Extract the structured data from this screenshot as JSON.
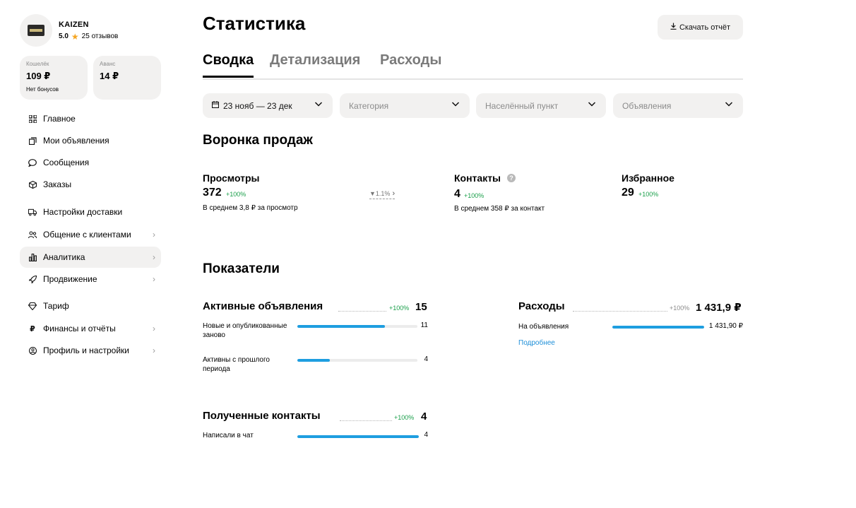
{
  "profile": {
    "name": "KAIZEN",
    "rating": "5.0",
    "reviews": "25 отзывов"
  },
  "wallet": {
    "label": "Кошелёк",
    "value": "109 ₽",
    "sub": "Нет бонусов"
  },
  "advance": {
    "label": "Аванс",
    "value": "14 ₽"
  },
  "sidebar": {
    "items": [
      {
        "label": "Главное",
        "icon": "grid-icon"
      },
      {
        "label": "Мои объявления",
        "icon": "copy-icon"
      },
      {
        "label": "Сообщения",
        "icon": "chat-icon"
      },
      {
        "label": "Заказы",
        "icon": "box-icon"
      },
      {
        "label": "Настройки доставки",
        "icon": "truck-icon"
      },
      {
        "label": "Общение с клиентами",
        "icon": "users-icon",
        "chevron": true
      },
      {
        "label": "Аналитика",
        "icon": "chart-icon",
        "chevron": true,
        "active": true
      },
      {
        "label": "Продвижение",
        "icon": "rocket-icon",
        "chevron": true
      },
      {
        "label": "Тариф",
        "icon": "diamond-icon"
      },
      {
        "label": "Финансы и отчёты",
        "icon": "ruble-icon",
        "chevron": true
      },
      {
        "label": "Профиль и настройки",
        "icon": "profile-icon",
        "chevron": true
      }
    ]
  },
  "header": {
    "title": "Статистика",
    "download_label": "Скачать отчёт"
  },
  "tabs": [
    {
      "label": "Сводка",
      "active": true
    },
    {
      "label": "Детализация"
    },
    {
      "label": "Расходы"
    }
  ],
  "filters": {
    "date": "23 нояб — 23 дек",
    "category": "Категория",
    "locality": "Населённый пункт",
    "ads": "Объявления"
  },
  "funnel": {
    "title": "Воронка продаж",
    "views": {
      "label": "Просмотры",
      "value": "372",
      "delta": "+100%",
      "sub": "В среднем 3,8 ₽ за просмотр",
      "conversion": "1.1%"
    },
    "contacts": {
      "label": "Контакты",
      "value": "4",
      "delta": "+100%",
      "sub": "В среднем 358 ₽ за контакт"
    },
    "favorites": {
      "label": "Избранное",
      "value": "29",
      "delta": "+100%"
    }
  },
  "indicators": {
    "title": "Показатели",
    "active_ads": {
      "title": "Активные объявления",
      "delta": "+100%",
      "value": "15",
      "rows": [
        {
          "label": "Новые и опубликованные заново",
          "value": "11",
          "fraction": 0.73
        },
        {
          "label": "Активны с прошлого периода",
          "value": "4",
          "fraction": 0.27
        }
      ]
    },
    "expenses": {
      "title": "Расходы",
      "delta": "+100%",
      "value": "1 431,9 ₽",
      "rows": [
        {
          "label": "На объявления",
          "value": "1 431,90 ₽",
          "fraction": 1.0
        }
      ],
      "link": "Подробнее"
    },
    "contacts": {
      "title": "Полученные контакты",
      "delta": "+100%",
      "value": "4",
      "rows": [
        {
          "label": "Написали в чат",
          "value": "4",
          "fraction": 1.0
        }
      ]
    }
  },
  "colors": {
    "accent": "#1e9ee0",
    "positive": "#1a9f4a",
    "surface": "#f2f1f0"
  }
}
